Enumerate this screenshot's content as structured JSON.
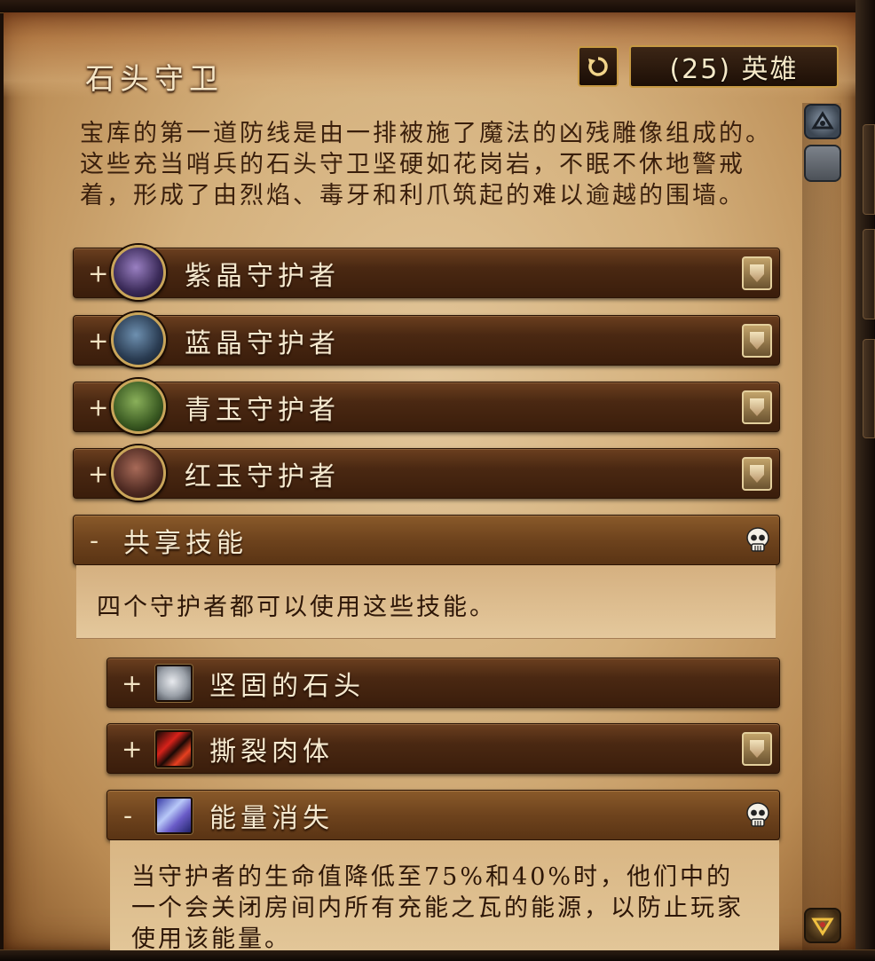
{
  "header": {
    "title": "石头守卫",
    "difficulty_label": "(25) 英雄",
    "reset_icon": "refresh-icon"
  },
  "description": "宝库的第一道防线是由一排被施了魔法的凶残雕像组成的。这些充当哨兵的石头守卫坚硬如花岗岩，不眠不休地警戒着，形成了由烈焰、毒牙和利爪筑起的难以逾越的围墙。",
  "bosses": [
    {
      "label": "紫晶守护者",
      "toggle": "+",
      "color": "#7a5a9c",
      "icon": "shield-icon"
    },
    {
      "label": "蓝晶守护者",
      "toggle": "+",
      "color": "#4e6f8e",
      "icon": "shield-icon"
    },
    {
      "label": "青玉守护者",
      "toggle": "+",
      "color": "#5c8a3a",
      "icon": "shield-icon"
    },
    {
      "label": "红玉守护者",
      "toggle": "+",
      "color": "#8a4a3a",
      "icon": "shield-icon"
    }
  ],
  "shared": {
    "toggle": "-",
    "label": "共享技能",
    "icon": "skull-icon",
    "text": "四个守护者都可以使用这些技能。"
  },
  "abilities": [
    {
      "toggle": "+",
      "label": "坚固的石头",
      "icon": "stone-icon",
      "role_icon": null
    },
    {
      "toggle": "+",
      "label": "撕裂肉体",
      "icon": "claw-icon",
      "role_icon": "shield-icon"
    },
    {
      "toggle": "-",
      "label": "能量消失",
      "icon": "energy-icon",
      "role_icon": "skull-icon"
    }
  ],
  "energy_text": "当守护者的生命值降低至75%和40%时，他们中的一个会关闭房间内所有充能之瓦的能源，以防止玩家使用该能量。",
  "scrollbar": {
    "up_icon": "scroll-up-icon",
    "down_icon": "scroll-down-icon"
  }
}
